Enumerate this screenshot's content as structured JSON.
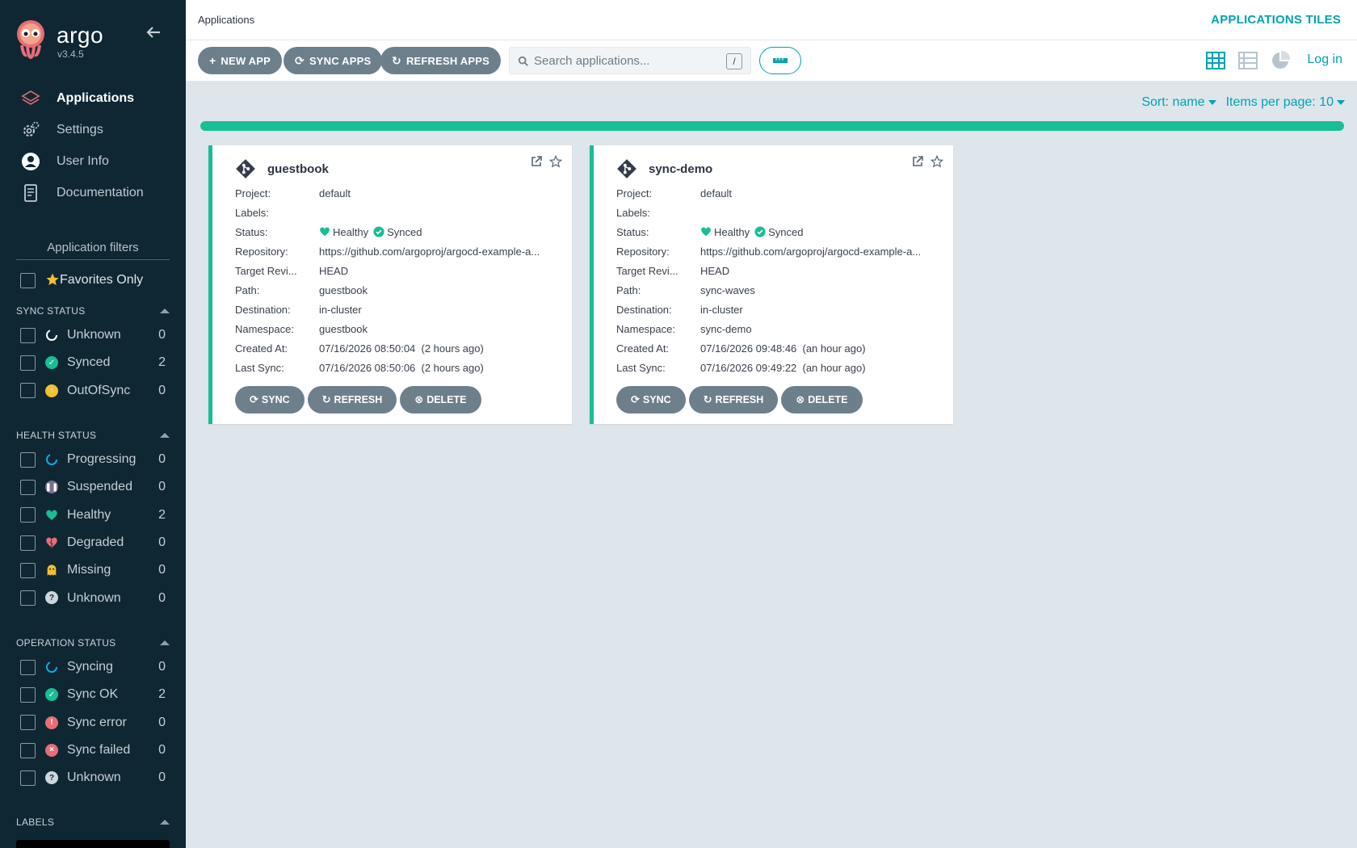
{
  "brand": {
    "name": "argo",
    "version": "v3.4.5"
  },
  "nav": [
    {
      "label": "Applications",
      "icon": "layers-icon",
      "active": true
    },
    {
      "label": "Settings",
      "icon": "gears-icon",
      "active": false
    },
    {
      "label": "User Info",
      "icon": "user-circle-icon",
      "active": false
    },
    {
      "label": "Documentation",
      "icon": "book-icon",
      "active": false
    }
  ],
  "filters": {
    "title": "Application filters",
    "favorites_label": "Favorites Only",
    "sync_status": {
      "title": "SYNC STATUS",
      "items": [
        {
          "label": "Unknown",
          "count": "0",
          "color": "#ffffff",
          "icon": "circle-notch-icon"
        },
        {
          "label": "Synced",
          "count": "2",
          "color": "#18be94",
          "icon": "check-circle-icon"
        },
        {
          "label": "OutOfSync",
          "count": "0",
          "color": "#f4c030",
          "icon": "arrow-up-circle-icon"
        }
      ]
    },
    "health_status": {
      "title": "HEALTH STATUS",
      "items": [
        {
          "label": "Progressing",
          "count": "0",
          "color": "#0dadea",
          "icon": "circle-notch-icon"
        },
        {
          "label": "Suspended",
          "count": "0",
          "color": "#766f94",
          "icon": "pause-circle-icon"
        },
        {
          "label": "Healthy",
          "count": "2",
          "color": "#18be94",
          "icon": "heart-icon"
        },
        {
          "label": "Degraded",
          "count": "0",
          "color": "#e96d76",
          "icon": "heart-broken-icon"
        },
        {
          "label": "Missing",
          "count": "0",
          "color": "#f4c030",
          "icon": "ghost-icon"
        },
        {
          "label": "Unknown",
          "count": "0",
          "color": "#ccd6dd",
          "icon": "question-circle-icon"
        }
      ]
    },
    "operation_status": {
      "title": "OPERATION STATUS",
      "items": [
        {
          "label": "Syncing",
          "count": "0",
          "color": "#0dadea",
          "icon": "circle-notch-icon"
        },
        {
          "label": "Sync OK",
          "count": "2",
          "color": "#18be94",
          "icon": "check-circle-icon"
        },
        {
          "label": "Sync error",
          "count": "0",
          "color": "#e96d76",
          "icon": "exclamation-circle-icon"
        },
        {
          "label": "Sync failed",
          "count": "0",
          "color": "#e96d76",
          "icon": "times-circle-icon"
        },
        {
          "label": "Unknown",
          "count": "0",
          "color": "#ccd6dd",
          "icon": "question-circle-icon"
        }
      ]
    },
    "labels_title": "LABELS"
  },
  "header": {
    "breadcrumb": "Applications",
    "title": "APPLICATIONS TILES",
    "login": "Log in"
  },
  "toolbar": {
    "new_app": "NEW APP",
    "sync_apps": "SYNC APPS",
    "refresh_apps": "REFRESH APPS",
    "search_placeholder": "Search applications...",
    "search_value": "",
    "search_shortcut": "/"
  },
  "sort": {
    "sort_label": "Sort: name",
    "items_per_page": "Items per page: 10"
  },
  "progress": {
    "fraction": 1.0
  },
  "colors": {
    "accent": "#00a2b3",
    "sidebar": "#0f2733",
    "healthy": "#18be94",
    "button": "#6d7f8b"
  },
  "field_labels": {
    "project": "Project:",
    "labels": "Labels:",
    "status": "Status:",
    "repository": "Repository:",
    "target": "Target Revi...",
    "path": "Path:",
    "destination": "Destination:",
    "namespace": "Namespace:",
    "created": "Created At:",
    "last_sync": "Last Sync:"
  },
  "card_buttons": {
    "sync": "SYNC",
    "refresh": "REFRESH",
    "delete": "DELETE"
  },
  "apps": [
    {
      "name": "guestbook",
      "project": "default",
      "labels": "",
      "health": "Healthy",
      "sync": "Synced",
      "repository": "https://github.com/argoproj/argocd-example-a...",
      "target": "HEAD",
      "path": "guestbook",
      "destination": "in-cluster",
      "namespace": "guestbook",
      "created": "07/16/2026 08:50:04  (2 hours ago)",
      "last_sync": "07/16/2026 08:50:06  (2 hours ago)"
    },
    {
      "name": "sync-demo",
      "project": "default",
      "labels": "",
      "health": "Healthy",
      "sync": "Synced",
      "repository": "https://github.com/argoproj/argocd-example-a...",
      "target": "HEAD",
      "path": "sync-waves",
      "destination": "in-cluster",
      "namespace": "sync-demo",
      "created": "07/16/2026 09:48:46  (an hour ago)",
      "last_sync": "07/16/2026 09:49:22  (an hour ago)"
    }
  ]
}
